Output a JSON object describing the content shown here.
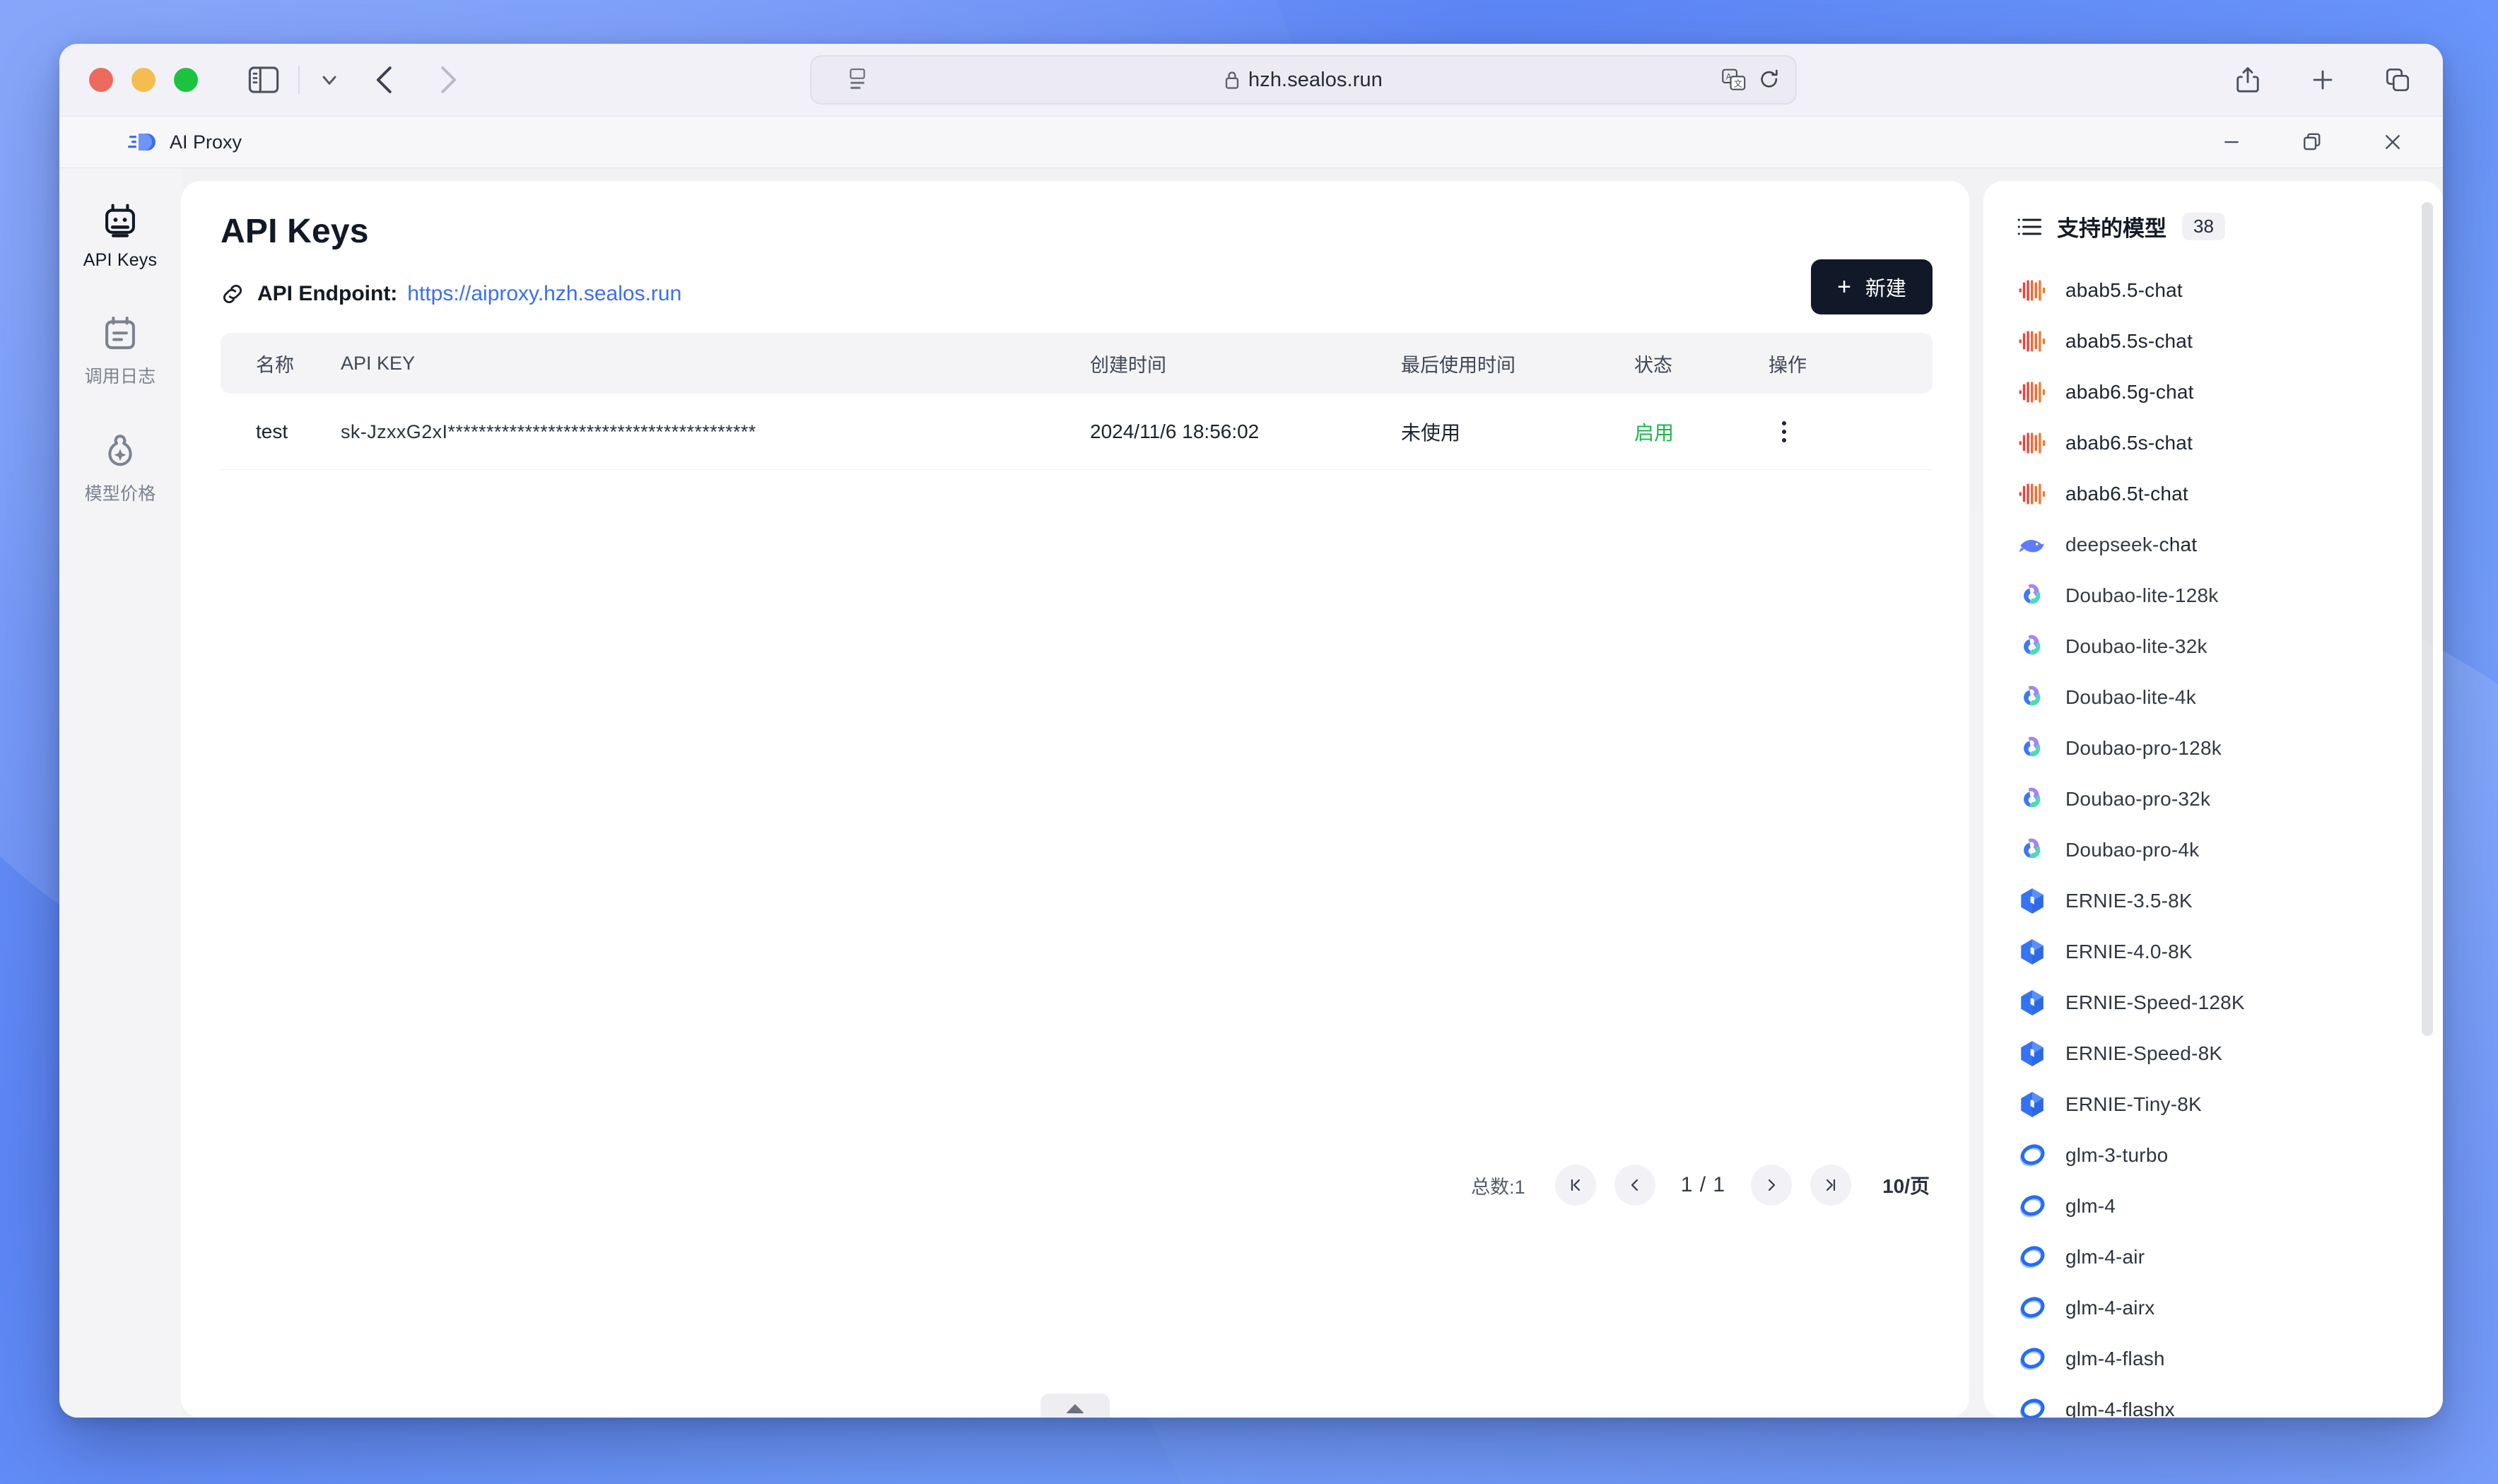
{
  "browser": {
    "url": "hzh.sealos.run",
    "icons": {
      "sidebar_toggle": "sidebar-toggle-icon",
      "dropdown": "chevron-down-icon",
      "back": "back-arrow-icon",
      "forward": "forward-arrow-icon",
      "reader": "reader-view-icon",
      "lock": "lock-icon",
      "translate": "translate-icon",
      "reload": "reload-icon",
      "share": "share-icon",
      "new_tab": "plus-icon",
      "tab_overview": "tab-overview-icon"
    }
  },
  "app_window": {
    "title": "AI Proxy",
    "minimize": "minimize-icon",
    "restore": "restore-icon",
    "close": "close-icon"
  },
  "sidebar": {
    "items": [
      {
        "label": "API Keys",
        "icon": "robot-icon",
        "active": true
      },
      {
        "label": "调用日志",
        "icon": "calendar-log-icon",
        "active": false
      },
      {
        "label": "模型价格",
        "icon": "price-tag-icon",
        "active": false
      }
    ]
  },
  "main": {
    "page_title": "API Keys",
    "endpoint_label": "API Endpoint:",
    "endpoint_url": "https://aiproxy.hzh.sealos.run",
    "endpoint_icon": "link-icon",
    "new_button": {
      "plus": "+",
      "label": "新建"
    },
    "table": {
      "headers": [
        "名称",
        "API KEY",
        "创建时间",
        "最后使用时间",
        "状态",
        "操作"
      ],
      "rows": [
        {
          "name": "test",
          "api_key": "sk-JzxxG2xI****************************************",
          "created_at": "2024/11/6 18:56:02",
          "last_used": "未使用",
          "status": "启用",
          "action_icon": "more-vertical-icon"
        }
      ]
    },
    "pagination": {
      "total": "总数:1",
      "first": "first-page-icon",
      "prev": "prev-page-icon",
      "pages": "1 / 1",
      "next": "next-page-icon",
      "last": "last-page-icon",
      "page_size": "10/页"
    },
    "collapse_handle": "collapse-panel-handle"
  },
  "models_panel": {
    "icon": "list-icon",
    "title": "支持的模型",
    "count": "38",
    "items": [
      {
        "name": "abab5.5-chat",
        "icon": "minimax-waveform-icon"
      },
      {
        "name": "abab5.5s-chat",
        "icon": "minimax-waveform-icon"
      },
      {
        "name": "abab6.5g-chat",
        "icon": "minimax-waveform-icon"
      },
      {
        "name": "abab6.5s-chat",
        "icon": "minimax-waveform-icon"
      },
      {
        "name": "abab6.5t-chat",
        "icon": "minimax-waveform-icon"
      },
      {
        "name": "deepseek-chat",
        "icon": "deepseek-whale-icon"
      },
      {
        "name": "Doubao-lite-128k",
        "icon": "doubao-icon"
      },
      {
        "name": "Doubao-lite-32k",
        "icon": "doubao-icon"
      },
      {
        "name": "Doubao-lite-4k",
        "icon": "doubao-icon"
      },
      {
        "name": "Doubao-pro-128k",
        "icon": "doubao-icon"
      },
      {
        "name": "Doubao-pro-32k",
        "icon": "doubao-icon"
      },
      {
        "name": "Doubao-pro-4k",
        "icon": "doubao-icon"
      },
      {
        "name": "ERNIE-3.5-8K",
        "icon": "ernie-hexagon-icon"
      },
      {
        "name": "ERNIE-4.0-8K",
        "icon": "ernie-hexagon-icon"
      },
      {
        "name": "ERNIE-Speed-128K",
        "icon": "ernie-hexagon-icon"
      },
      {
        "name": "ERNIE-Speed-8K",
        "icon": "ernie-hexagon-icon"
      },
      {
        "name": "ERNIE-Tiny-8K",
        "icon": "ernie-hexagon-icon"
      },
      {
        "name": "glm-3-turbo",
        "icon": "glm-ring-icon"
      },
      {
        "name": "glm-4",
        "icon": "glm-ring-icon"
      },
      {
        "name": "glm-4-air",
        "icon": "glm-ring-icon"
      },
      {
        "name": "glm-4-airx",
        "icon": "glm-ring-icon"
      },
      {
        "name": "glm-4-flash",
        "icon": "glm-ring-icon"
      },
      {
        "name": "glm-4-flashx",
        "icon": "glm-ring-icon"
      }
    ]
  },
  "colors": {
    "accent_blue": "#3a6ff0",
    "status_green": "#1ab74a",
    "button_dark": "#111827",
    "minimax_red": "#e8453c",
    "deepseek_blue": "#4d6bfe",
    "ernie_blue": "#2468f2",
    "glm_blue": "#1763f2",
    "doubao_purple": "#9a7af2"
  }
}
